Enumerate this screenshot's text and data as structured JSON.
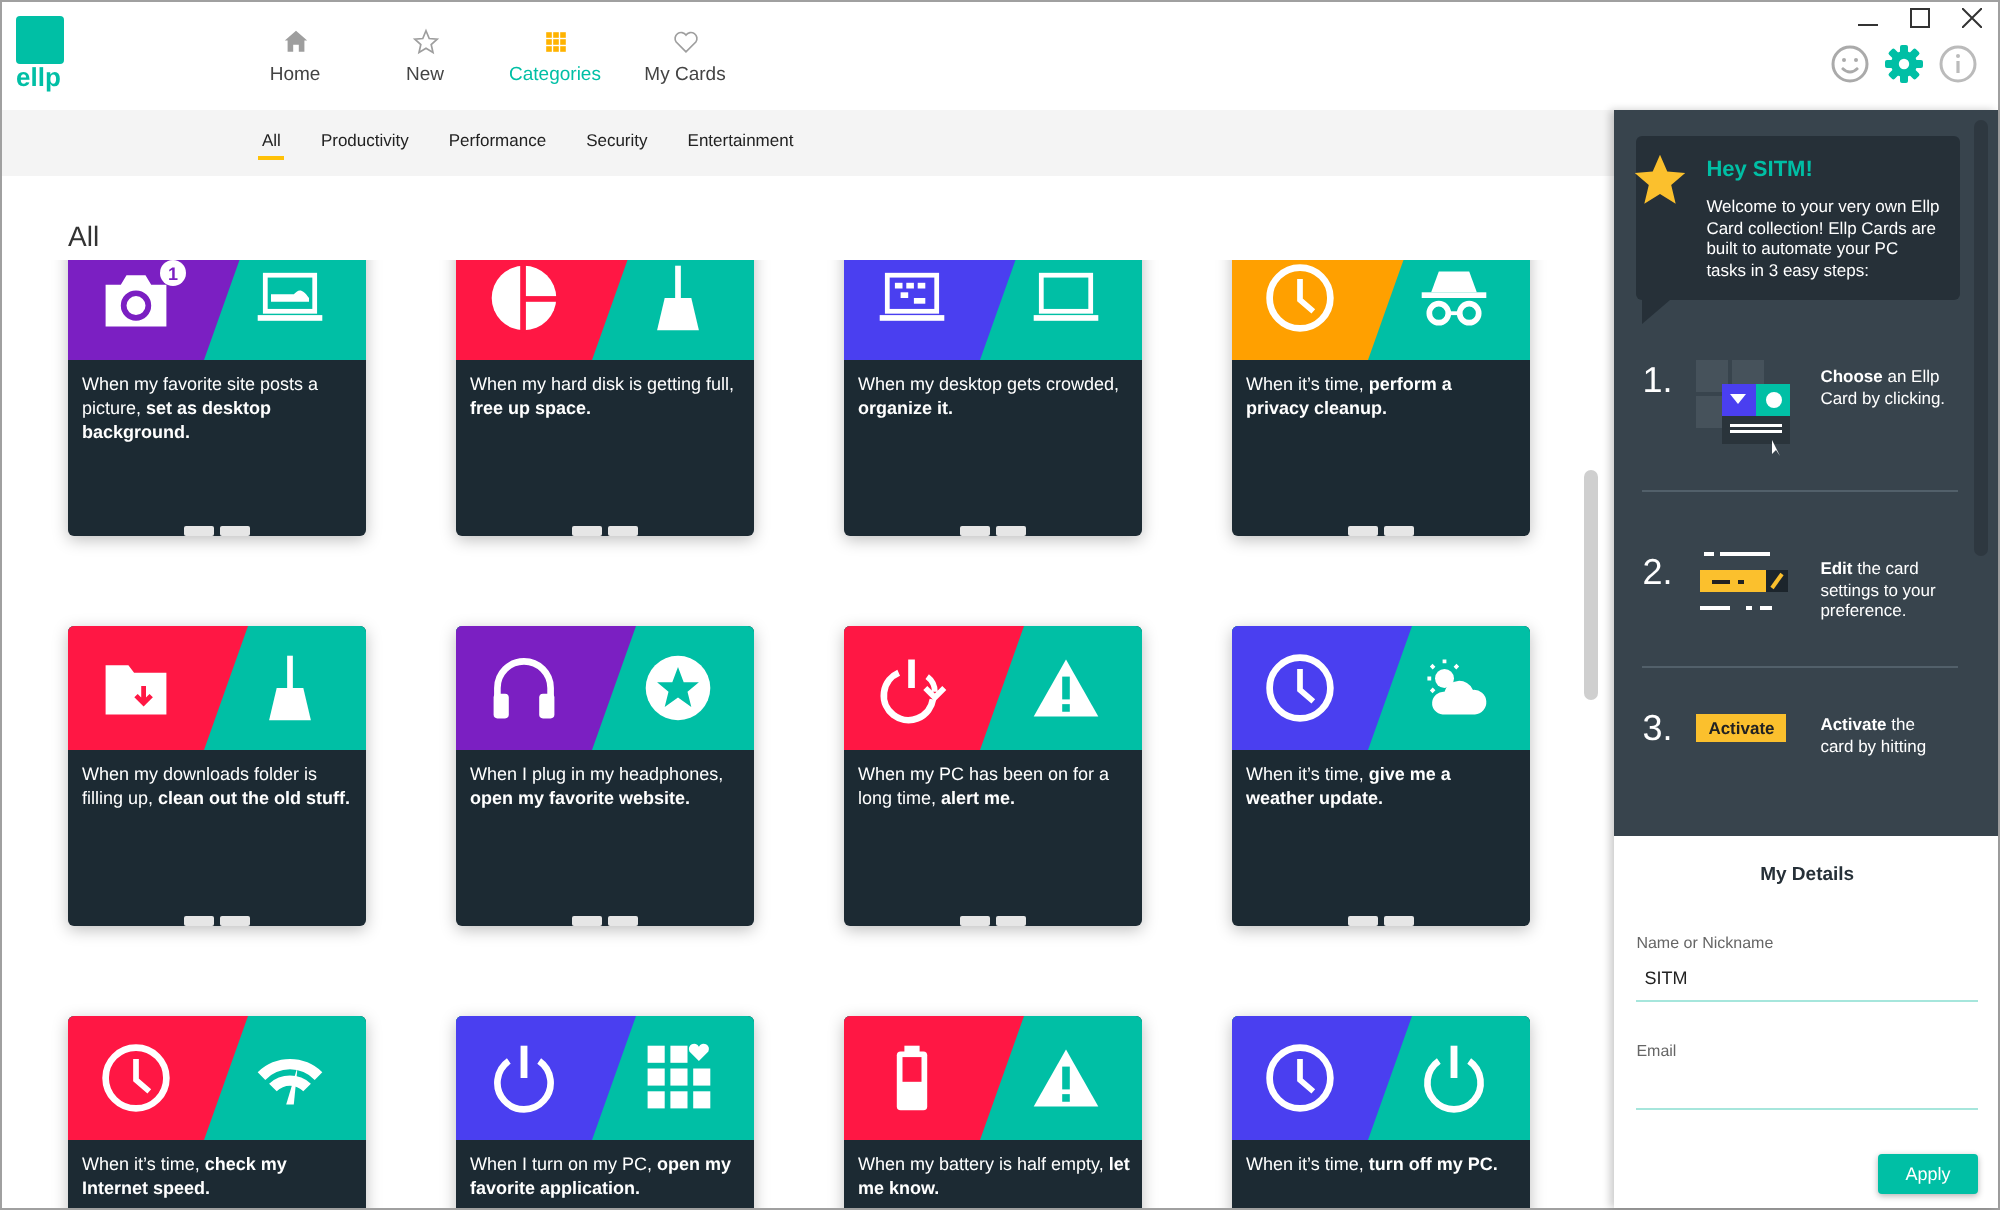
{
  "app": {
    "logo": "ellp"
  },
  "nav": [
    {
      "label": "Home",
      "selected": false
    },
    {
      "label": "New",
      "selected": false
    },
    {
      "label": "Categories",
      "selected": true
    },
    {
      "label": "My Cards",
      "selected": false
    }
  ],
  "subtabs": [
    {
      "label": "All",
      "selected": true
    },
    {
      "label": "Productivity",
      "selected": false
    },
    {
      "label": "Performance",
      "selected": false
    },
    {
      "label": "Security",
      "selected": false
    },
    {
      "label": "Entertainment",
      "selected": false
    }
  ],
  "section_title": "All",
  "cards": [
    {
      "color": "#7b1fc2",
      "text": "When my favorite site posts a picture, **set as desktop background.**",
      "badge": "1"
    },
    {
      "color": "#ff1744",
      "text": "When my hard disk is getting full, **free up space.**"
    },
    {
      "color": "#4a3ff0",
      "text": "When my desktop gets crowded, **organize it.**"
    },
    {
      "color": "#ffa000",
      "text": "When it’s time, **perform a privacy cleanup.**"
    },
    {
      "color": "#ff1744",
      "text": "When my downloads folder is filling up, **clean out the old stuff.**"
    },
    {
      "color": "#7b1fc2",
      "text": "When I plug in my headphones, **open my favorite website.**"
    },
    {
      "color": "#ff1744",
      "text": "When my PC has been on for a long time, **alert me.**"
    },
    {
      "color": "#4a3ff0",
      "text": "When it’s time, **give me a weather update.**"
    },
    {
      "color": "#ff1744",
      "text": "When it’s time, **check my Internet speed.**"
    },
    {
      "color": "#4a3ff0",
      "text": "When I turn on my PC, **open my favorite application.**"
    },
    {
      "color": "#ff1744",
      "text": "When my battery is half empty, **let me know.**"
    },
    {
      "color": "#4a3ff0",
      "text": "When it’s time, **turn off my PC.**"
    }
  ],
  "welcome": {
    "title": "Hey SITM!",
    "text": "Welcome to your very own Ellp Card collection! Ellp Cards are built to automate your PC tasks in 3 easy steps:"
  },
  "steps": [
    {
      "number": "1.",
      "text": "**Choose** an Ellp Card by clicking."
    },
    {
      "number": "2.",
      "text": "**Edit** the card settings to your preference."
    },
    {
      "number": "3.",
      "button": "Activate",
      "text": "**Activate** the card by hitting"
    }
  ],
  "details": {
    "title": "My Details",
    "fields": [
      {
        "label": "Name or Nickname",
        "value": "SITM"
      },
      {
        "label": "Email"
      }
    ],
    "apply": "Apply"
  }
}
